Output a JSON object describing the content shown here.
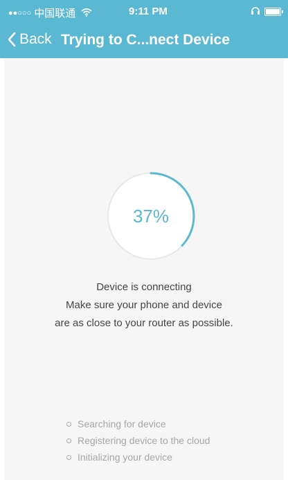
{
  "status_bar": {
    "signal_dots": "●●○○○",
    "carrier": "中国联通",
    "time": "9:11 PM"
  },
  "nav": {
    "back_label": "Back",
    "title": "Trying to C...nect Device"
  },
  "progress": {
    "percent_text": "37%",
    "value": 0.37,
    "accent_color": "#5bb8d3"
  },
  "message": {
    "line1": "Device is connecting",
    "line2": "Make sure your phone and device",
    "line3": "are as close to your router as possible."
  },
  "steps": [
    {
      "label": "Searching for device"
    },
    {
      "label": "Registering device to the cloud"
    },
    {
      "label": "Initializing your device"
    }
  ],
  "icons": {
    "back": "chevron-left-icon",
    "wifi": "wifi-icon",
    "headphones": "headphones-icon",
    "battery": "battery-icon"
  }
}
